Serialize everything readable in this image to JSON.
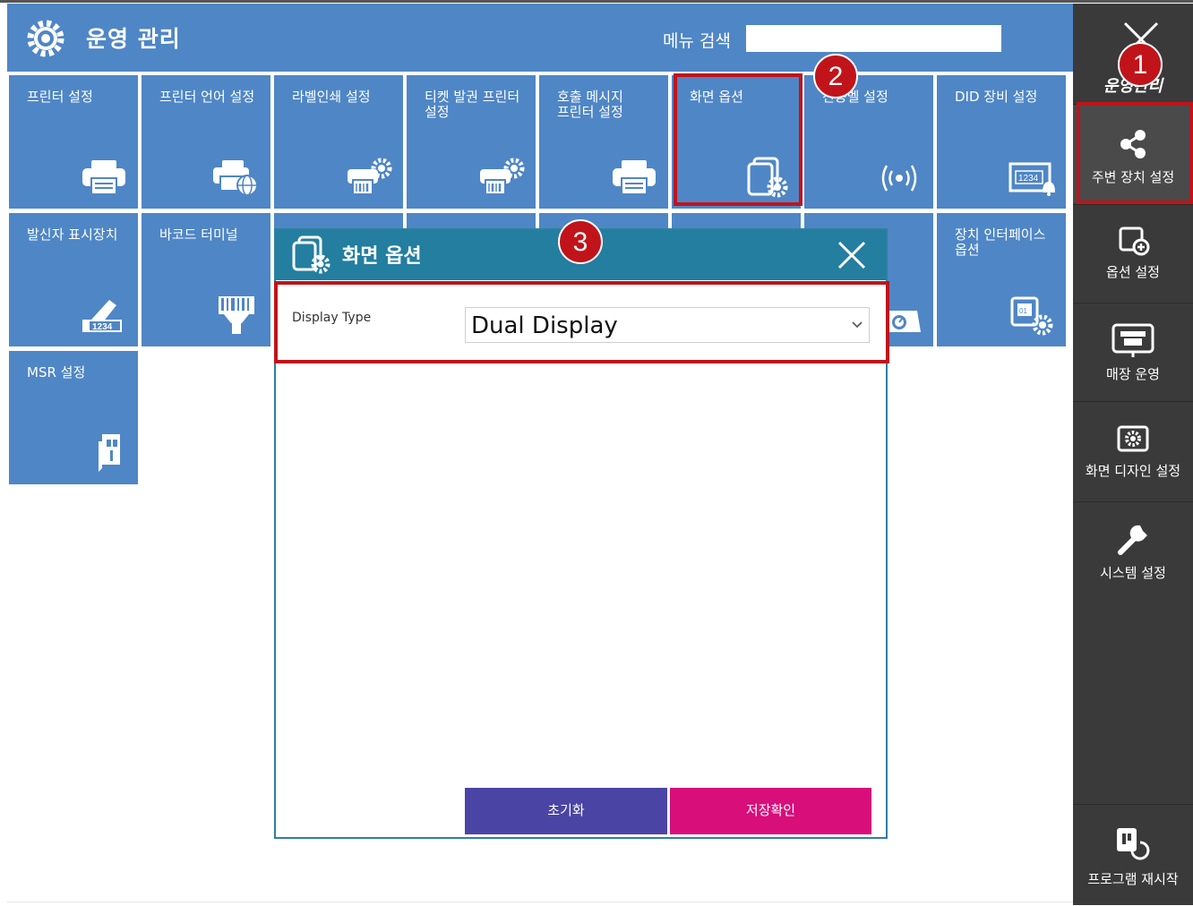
{
  "header": {
    "title": "운영 관리",
    "search_label": "메뉴 검색",
    "search_value": ""
  },
  "tiles": [
    {
      "label": "프린터 설정",
      "icon": "printer-icon"
    },
    {
      "label": "프린터 언어 설정",
      "icon": "printer-globe-icon"
    },
    {
      "label": "라벨인쇄 설정",
      "icon": "label-printer-gear-icon"
    },
    {
      "label": "티켓 발권 프린터 설정",
      "icon": "ticket-printer-gear-icon"
    },
    {
      "label": "호출 메시지 프린터 설정",
      "icon": "printer-icon"
    },
    {
      "label": "화면 옵션",
      "icon": "screen-gear-icon"
    },
    {
      "label": "진동벨 설정",
      "icon": "vibration-bell-icon"
    },
    {
      "label": "DID 장비 설정",
      "icon": "did-display-bell-icon"
    },
    {
      "label": "발신자 표시장치",
      "icon": "caller-id-phone-icon"
    },
    {
      "label": "바코드 터미널",
      "icon": "barcode-scanner-icon"
    },
    {
      "label": "",
      "icon": ""
    },
    {
      "label": "",
      "icon": ""
    },
    {
      "label": "",
      "icon": ""
    },
    {
      "label": "",
      "icon": ""
    },
    {
      "label": "",
      "icon": "scale-icon"
    },
    {
      "label": "장치 인터페이스 옵션",
      "icon": "device-interface-gear-icon"
    },
    {
      "label": "MSR 설정",
      "icon": "card-reader-icon"
    }
  ],
  "sidebar": {
    "section_title": "운영관리",
    "items": [
      {
        "label": "주변 장치 설정",
        "icon": "share-nodes-icon",
        "active": true
      },
      {
        "label": "옵션 설정",
        "icon": "screen-plus-icon"
      },
      {
        "label": "매장 운영",
        "icon": "store-monitor-icon"
      },
      {
        "label": "화면 디자인 설정",
        "icon": "screen-design-gear-icon"
      },
      {
        "label": "시스템 설정",
        "icon": "wrench-icon"
      }
    ],
    "restart_label": "프로그램 재시작"
  },
  "dialog": {
    "title": "화면 옵션",
    "field_label": "Display Type",
    "selected_value": "Dual Display",
    "options": [
      "Dual Display"
    ],
    "reset_label": "초기화",
    "save_label": "저장확인"
  },
  "annotations": {
    "badge1": "1",
    "badge2": "2",
    "badge3": "3",
    "color": "#c0141a"
  },
  "colors": {
    "tile": "#4f86c6",
    "sidebar": "#3a3a3a",
    "dialog_header": "#237ea0",
    "reset_button": "#4a45a5",
    "save_button": "#d80e7a"
  }
}
